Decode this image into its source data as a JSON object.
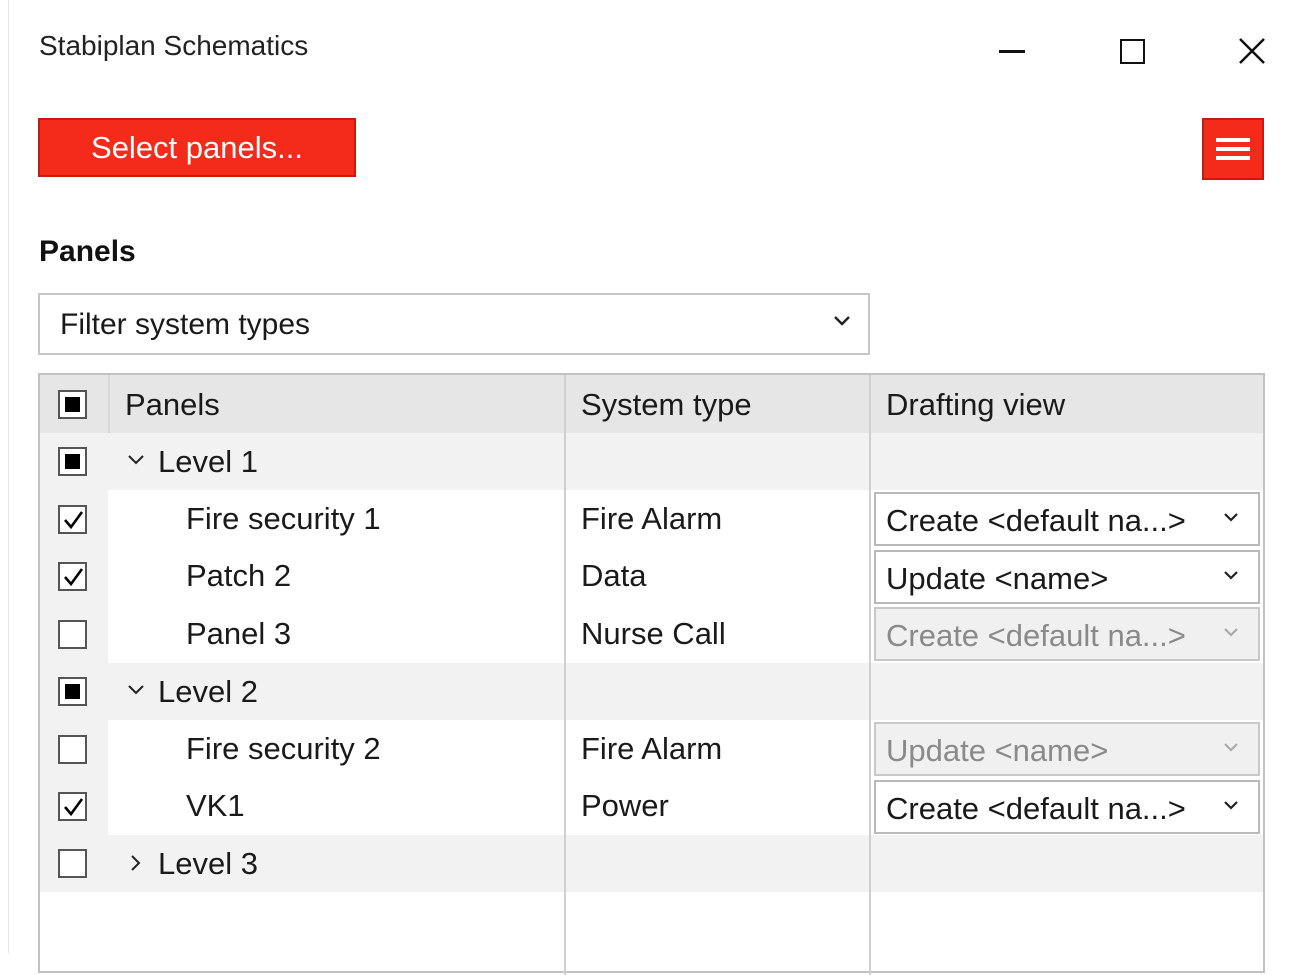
{
  "window": {
    "title": "Stabiplan Schematics",
    "controls": [
      "minimize",
      "maximize",
      "close"
    ]
  },
  "toolbar": {
    "select_panels_label": "Select panels...",
    "menu_icon": "hamburger-menu-icon",
    "accent_color": "#f42b1a"
  },
  "section": {
    "title": "Panels"
  },
  "filter": {
    "placeholder": "Filter system types"
  },
  "table": {
    "headers": {
      "panels": "Panels",
      "system_type": "System type",
      "drafting_view": "Drafting view"
    },
    "header_checkbox": "partial",
    "rows": [
      {
        "kind": "group",
        "label": "Level 1",
        "expanded": true,
        "check": "partial"
      },
      {
        "kind": "item",
        "label": "Fire security 1",
        "system_type": "Fire Alarm",
        "check": "checked",
        "view": "Create <default na...>",
        "view_enabled": true
      },
      {
        "kind": "item",
        "label": "Patch 2",
        "system_type": "Data",
        "check": "checked",
        "view": "Update <name>",
        "view_enabled": true
      },
      {
        "kind": "item",
        "label": "Panel 3",
        "system_type": "Nurse Call",
        "check": "unchecked",
        "view": "Create <default na...>",
        "view_enabled": false
      },
      {
        "kind": "group",
        "label": "Level 2",
        "expanded": true,
        "check": "partial"
      },
      {
        "kind": "item",
        "label": "Fire security 2",
        "system_type": "Fire Alarm",
        "check": "unchecked",
        "view": "Update <name>",
        "view_enabled": false
      },
      {
        "kind": "item",
        "label": "VK1",
        "system_type": "Power",
        "check": "checked",
        "view": "Create <default na...>",
        "view_enabled": true
      },
      {
        "kind": "group",
        "label": "Level 3",
        "expanded": false,
        "check": "unchecked"
      }
    ]
  }
}
